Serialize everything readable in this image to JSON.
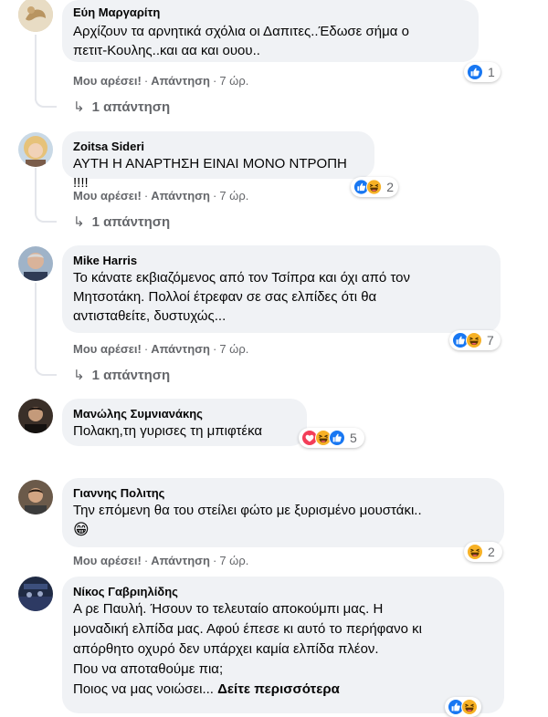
{
  "actions": {
    "like": "Μου αρέσει!",
    "reply": "Απάντηση",
    "separator": "·",
    "time": "7 ώρ."
  },
  "comments": [
    {
      "author": "Εύη Μαργαρίτη",
      "text": "Αρχίζουν τα αρνητικά σχόλια οι Δαπιτες..Έδωσε σήμα ο\nπετιτ-Κουλης..και αα και ουου..",
      "reactions": [
        "like"
      ],
      "reaction_count": "1",
      "replies": "1 απάντηση"
    },
    {
      "author": "Zoitsa Sideri",
      "text": "ΑΥΤΗ Η ΑΝΑΡΤΗΣΗ ΕΙΝΑΙ ΜΟΝΟ ΝΤΡΟΠΗ !!!!",
      "reactions": [
        "like",
        "haha"
      ],
      "reaction_count": "2",
      "replies": "1 απάντηση"
    },
    {
      "author": "Mike Harris",
      "text": "Το κάνατε εκβιαζόμενος από τον Τσίπρα και όχι από τον\nΜητσοτάκη. Πολλοί έτρεφαν σε σας ελπίδες ότι θα\nαντισταθείτε, δυστυχώς...",
      "reactions": [
        "like",
        "haha"
      ],
      "reaction_count": "7",
      "replies": "1 απάντηση"
    },
    {
      "author": "Μανώλης Συμνιανάκης",
      "text": "Πολακη,τη γυρισες τη μπιφτέκα",
      "reactions": [
        "love",
        "haha",
        "like"
      ],
      "reaction_count": "5"
    },
    {
      "author": "Γιαννης Πολιτης",
      "text": "Την επόμενη θα του στείλει φώτο με ξυρισμένο μουστάκι..",
      "emoji": "😁",
      "reactions": [
        "haha"
      ],
      "reaction_count": "2"
    },
    {
      "author": "Νίκος Γαβριηλίδης",
      "text": "Α ρε Παυλή. Ήσουν το τελευταίο αποκούμπι μας. Η\nμοναδική ελπίδα μας. Αφού έπεσε κι αυτό το περήφανο κι\nαπόρθητο οχυρό δεν υπάρχει καμία ελπίδα πλέον.\nΠου να αποταθούμε πια;",
      "last_line": "Ποιος να μας νοιώσει...",
      "see_more": "Δείτε περισσότερα",
      "reactions": [
        "like",
        "haha"
      ]
    }
  ],
  "colors": {
    "bubble": "#f0f2f5",
    "secondary_text": "#65676b",
    "like_blue": "#1877f2",
    "love_red": "#f33e58",
    "haha_yellow": "#f7b125"
  }
}
